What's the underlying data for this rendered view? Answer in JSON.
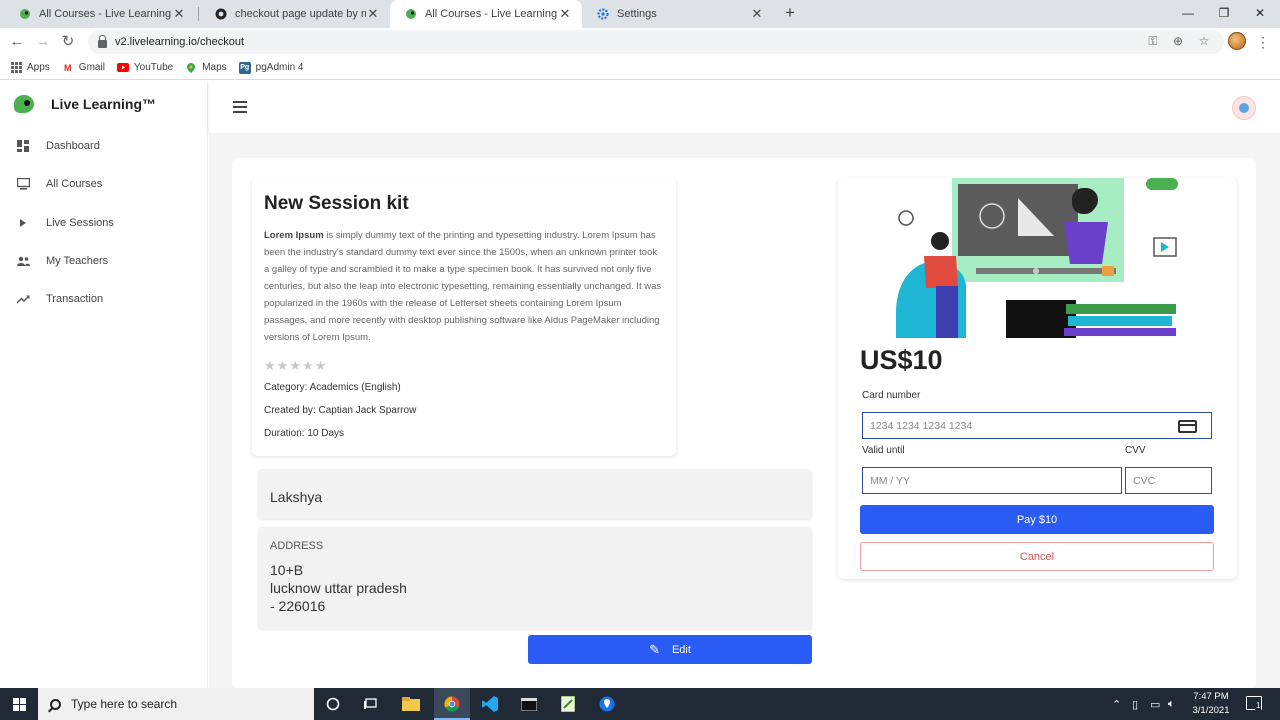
{
  "browser": {
    "tabs": [
      {
        "label": "All Courses - Live Learning",
        "favicon": "live-learning-icon",
        "active": false
      },
      {
        "label": "checkout page update by murug",
        "favicon": "github-icon",
        "active": false
      },
      {
        "label": "All Courses - Live Learning",
        "favicon": "live-learning-icon",
        "active": true
      },
      {
        "label": "Settings",
        "favicon": "gear-icon",
        "active": false
      }
    ],
    "url": "v2.livelearning.io/checkout",
    "bookmarks": [
      {
        "label": "Apps",
        "icon": "apps-grid-icon"
      },
      {
        "label": "Gmail",
        "icon": "gmail-icon"
      },
      {
        "label": "YouTube",
        "icon": "youtube-icon"
      },
      {
        "label": "Maps",
        "icon": "maps-icon"
      },
      {
        "label": "pgAdmin 4",
        "icon": "pgadmin-icon"
      }
    ]
  },
  "app": {
    "brand": "Live Learning™",
    "nav": [
      {
        "label": "Dashboard",
        "icon": "dashboard-icon"
      },
      {
        "label": "All Courses",
        "icon": "courses-icon"
      },
      {
        "label": "Live Sessions",
        "icon": "play-icon"
      },
      {
        "label": "My Teachers",
        "icon": "people-icon"
      },
      {
        "label": "Transaction",
        "icon": "trending-icon"
      }
    ]
  },
  "course": {
    "title": "New Session kit",
    "desc_lead": "Lorem Ipsum",
    "desc_body": " is simply dummy text of the printing and typesetting industry. Lorem Ipsum has been the industry's standard dummy text ever since the 1500s, when an unknown printer took a galley of type and scrambled it to make a type specimen book. It has survived not only five centuries, but also the leap into electronic typesetting, remaining essentially unchanged. It was popularized in the 1960s with the release of Letterset sheets containing Lorem Ipsum passages, and more recently with desktop publishing software like Aldus PageMaker including versions of Lorem Ipsum.",
    "rating": 0,
    "rating_max": 5,
    "category": "Category: Academics (English)",
    "created_by": "Created by: Captian Jack Sparrow",
    "duration": "Duration: 10 Days"
  },
  "customer": {
    "name": "Lakshya",
    "address_label": "ADDRESS",
    "address_lines": [
      "10+B",
      "lucknow uttar pradesh",
      "- 226016"
    ],
    "edit_label": "Edit"
  },
  "payment": {
    "price": "US$10",
    "card_number_label": "Card number",
    "card_number_placeholder": "1234 1234 1234 1234",
    "valid_until_label": "Valid until",
    "valid_until_placeholder": "MM / YY",
    "cvv_label": "CVV",
    "cvc_placeholder": "CVC",
    "pay_label": "Pay $10",
    "cancel_label": "Cancel"
  },
  "taskbar": {
    "search_placeholder": "Type here to search",
    "time": "7:47 PM",
    "date": "3/1/2021",
    "notification_count": "1"
  },
  "colors": {
    "primary": "#2a5bf5",
    "brand_green": "#4caf50",
    "cancel_red": "#d9534f"
  }
}
